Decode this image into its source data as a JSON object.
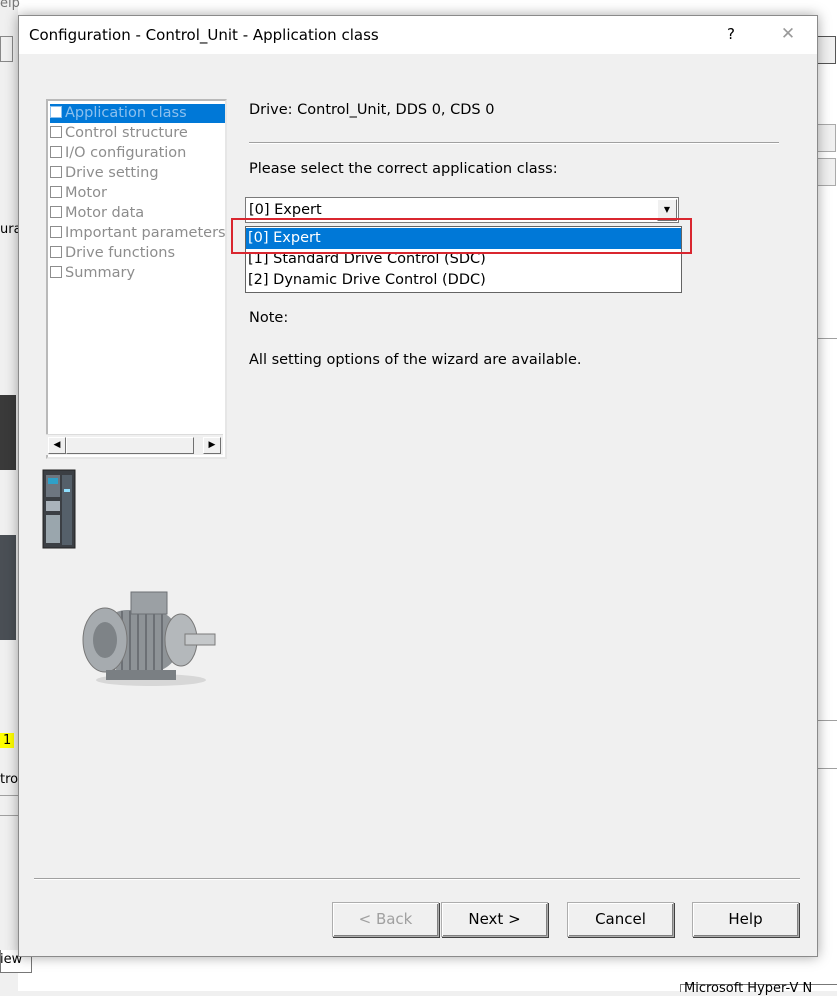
{
  "background": {
    "menu_fragment": "elp",
    "side_label_1": "urat",
    "tag_value": "1",
    "side_label_2": "trol",
    "tab_fragment": "iew",
    "status_fragment": "Microsoft Hyper-V N"
  },
  "dialog": {
    "title": "Configuration - Control_Unit - Application class",
    "help_glyph": "?",
    "close_glyph": "✕"
  },
  "steps": [
    {
      "label": "Application class",
      "active": true
    },
    {
      "label": "Control structure",
      "active": false
    },
    {
      "label": "I/O configuration",
      "active": false
    },
    {
      "label": "Drive setting",
      "active": false
    },
    {
      "label": "Motor",
      "active": false
    },
    {
      "label": "Motor data",
      "active": false
    },
    {
      "label": "Important parameters",
      "active": false
    },
    {
      "label": "Drive functions",
      "active": false
    },
    {
      "label": "Summary",
      "active": false
    }
  ],
  "panel": {
    "drive_info": "Drive: Control_Unit, DDS 0, CDS 0",
    "prompt": "Please select the correct application class:",
    "combo_value": "[0] Expert",
    "options": [
      "[0] Expert",
      "[1] Standard Drive Control (SDC)",
      "[2] Dynamic Drive Control (DDC)"
    ],
    "selected_index": 0,
    "note_label": "Note:",
    "note_text": "All setting options of the wizard are available."
  },
  "buttons": {
    "back": "< Back",
    "next": "Next >",
    "cancel": "Cancel",
    "help": "Help"
  },
  "colors": {
    "selection": "#0078d7",
    "highlight_box": "#d9262f"
  }
}
